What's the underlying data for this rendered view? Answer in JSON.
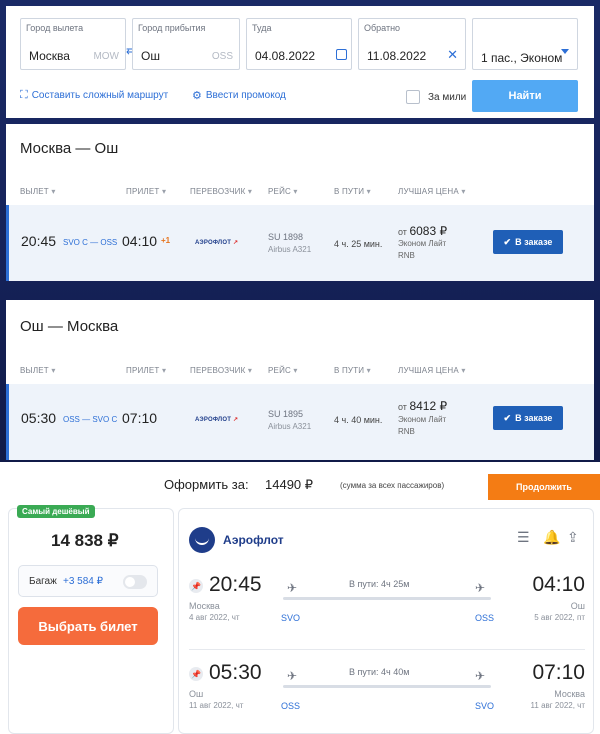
{
  "search": {
    "from_label": "Город вылета",
    "from_value": "Москва",
    "from_code": "MOW",
    "swap_icon": "swap-arrows-icon",
    "to_label": "Город прибытия",
    "to_value": "Ош",
    "to_code": "OSS",
    "depart_label": "Туда",
    "depart_value": "04.08.2022",
    "return_label": "Обратно",
    "return_value": "11.08.2022",
    "passengers_value": "1 пас., Эконом",
    "complex_route_link": "Составить сложный маршрут",
    "promo_link": "Ввести промокод",
    "miles_label": "За мили",
    "find_button": "Найти"
  },
  "headers": {
    "dep": "ВЫЛЕТ",
    "arr": "ПРИЛЕТ",
    "carrier": "ПЕРЕВОЗЧИК",
    "flight": "РЕЙС",
    "duration": "В ПУТИ",
    "best_price": "ЛУЧШАЯ ЦЕНА"
  },
  "outbound": {
    "title": "Москва — Ош",
    "dep_time": "20:45",
    "route": "SVO C — OSS",
    "arr_time": "04:10",
    "next_day": "+1",
    "carrier_logo": "АЭРОФЛОТ",
    "flight_no": "SU 1898",
    "aircraft": "Airbus A321",
    "duration": "4 ч. 25 мин.",
    "price_prefix": "от",
    "price": "6083 ₽",
    "fare": "Эконом Лайт",
    "fare_code": "RNB",
    "book_button": "В заказе"
  },
  "inbound": {
    "title": "Ош — Москва",
    "dep_time": "05:30",
    "route": "OSS — SVO C",
    "arr_time": "07:10",
    "carrier_logo": "АЭРОФЛОТ",
    "flight_no": "SU 1895",
    "aircraft": "Airbus A321",
    "duration": "4 ч. 40 мин.",
    "price_prefix": "от",
    "price": "8412 ₽",
    "fare": "Эконом Лайт",
    "fare_code": "RNB",
    "book_button": "В заказе"
  },
  "checkout": {
    "label": "Оформить за:",
    "sum": "14490 ₽",
    "note": "(сумма за всех пассажиров)",
    "continue_button": "Продолжить"
  },
  "ticket": {
    "badge": "Самый дешёвый",
    "price": "14 838 ₽",
    "baggage_label": "Багаж",
    "baggage_price": "+3 584 ₽",
    "select_button": "Выбрать билет",
    "airline": "Аэрофлот",
    "segments": [
      {
        "dep_time": "20:45",
        "arr_time": "04:10",
        "duration": "В пути: 4ч 25м",
        "dep_city": "Москва",
        "arr_city": "Ош",
        "dep_date": "4 авг 2022, чт",
        "arr_date": "5 авг 2022, пт",
        "dep_code": "SVO",
        "arr_code": "OSS"
      },
      {
        "dep_time": "05:30",
        "arr_time": "07:10",
        "duration": "В пути: 4ч 40м",
        "dep_city": "Ош",
        "arr_city": "Москва",
        "dep_date": "11 авг 2022, чт",
        "arr_date": "11 авг 2022, чт",
        "dep_code": "OSS",
        "arr_code": "SVO"
      }
    ]
  }
}
